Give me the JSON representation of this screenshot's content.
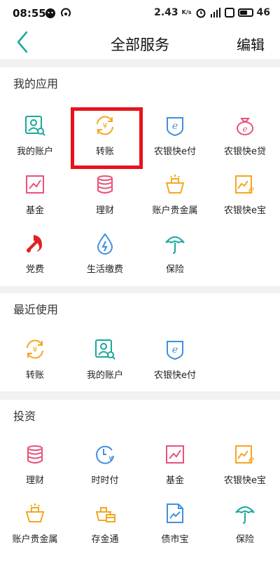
{
  "status_bar": {
    "time": "08:55",
    "speed": "2.43",
    "speed_unit": "K/s",
    "signal": "46"
  },
  "header": {
    "title": "全部服务",
    "edit_label": "编辑"
  },
  "sections": {
    "my_apps": {
      "title": "我的应用",
      "items": [
        {
          "label": "我的账户",
          "icon": "account-icon"
        },
        {
          "label": "转账",
          "icon": "transfer-icon"
        },
        {
          "label": "农银快e付",
          "icon": "e-pay-icon"
        },
        {
          "label": "农银快e贷",
          "icon": "e-loan-icon"
        },
        {
          "label": "基金",
          "icon": "fund-icon"
        },
        {
          "label": "理财",
          "icon": "wealth-icon"
        },
        {
          "label": "账户贵金属",
          "icon": "precious-metal-icon"
        },
        {
          "label": "农银快e宝",
          "icon": "e-bao-icon"
        },
        {
          "label": "党费",
          "icon": "party-fee-icon"
        },
        {
          "label": "生活缴费",
          "icon": "utility-payment-icon"
        },
        {
          "label": "保险",
          "icon": "insurance-icon"
        }
      ]
    },
    "recent": {
      "title": "最近使用",
      "items": [
        {
          "label": "转账",
          "icon": "transfer-icon"
        },
        {
          "label": "我的账户",
          "icon": "account-icon"
        },
        {
          "label": "农银快e付",
          "icon": "e-pay-icon"
        }
      ]
    },
    "invest": {
      "title": "投资",
      "items": [
        {
          "label": "理财",
          "icon": "wealth-icon"
        },
        {
          "label": "时时付",
          "icon": "clock-pay-icon"
        },
        {
          "label": "基金",
          "icon": "fund-icon"
        },
        {
          "label": "农银快e宝",
          "icon": "e-bao-icon"
        },
        {
          "label": "账户贵金属",
          "icon": "precious-metal-icon"
        },
        {
          "label": "存金通",
          "icon": "gold-deposit-icon"
        },
        {
          "label": "债市宝",
          "icon": "bond-icon"
        },
        {
          "label": "保险",
          "icon": "insurance-icon"
        }
      ]
    }
  },
  "colors": {
    "teal": "#1aa89a",
    "orange": "#f5a623",
    "pink": "#e8537a",
    "blue": "#3f8fe0",
    "red": "#e02020",
    "highlight": "#e8121c"
  }
}
